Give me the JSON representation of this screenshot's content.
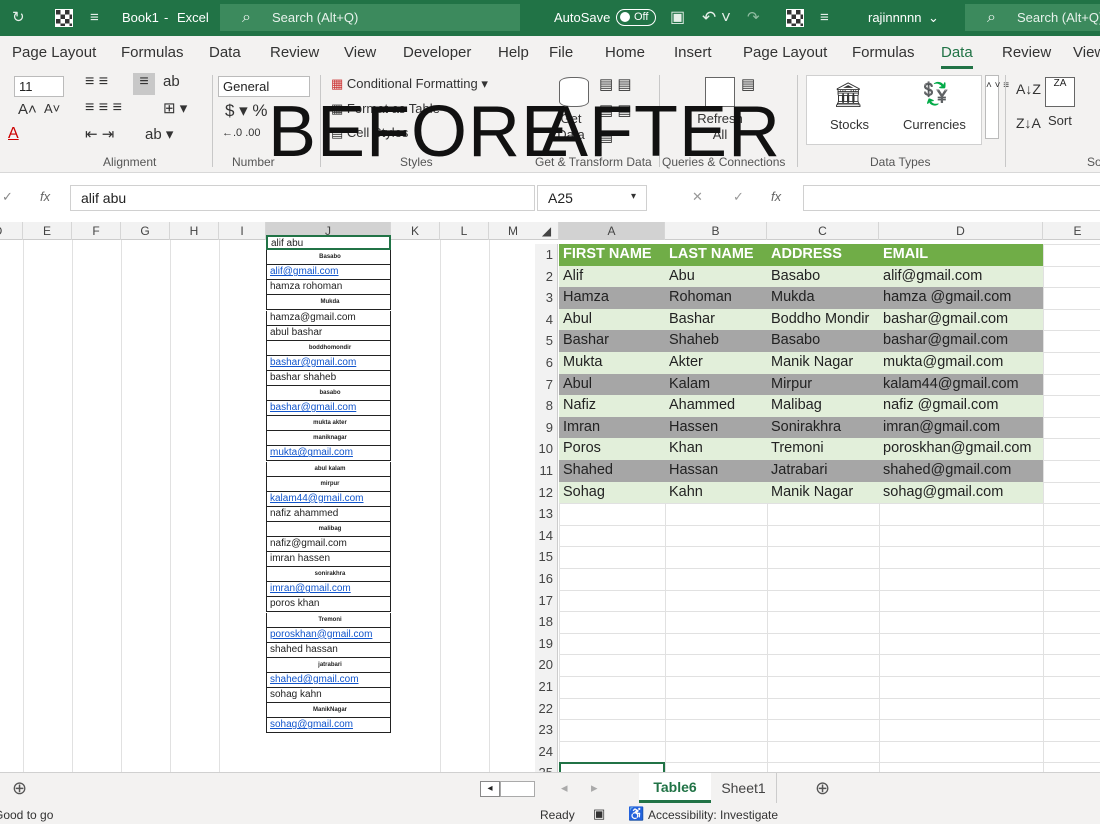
{
  "overlay": {
    "before": "BEFORE",
    "after": "AFTER"
  },
  "left": {
    "title": {
      "book": "Book1",
      "sep": "-",
      "app": "Excel",
      "search": "Search (Alt+Q)"
    },
    "menu": [
      "Page Layout",
      "Formulas",
      "Data",
      "Review",
      "View",
      "Developer",
      "Help"
    ],
    "ribbon": {
      "font_size": "11",
      "number_format": "General",
      "styles_items": [
        "Conditional Formatting",
        "Format as Table",
        "Cell Styles"
      ],
      "groups": [
        "Alignment",
        "Number",
        "Styles"
      ]
    },
    "formula": {
      "fx": "fx",
      "value": "alif abu"
    },
    "columns": [
      "D",
      "E",
      "F",
      "G",
      "H",
      "I",
      "J",
      "K",
      "L",
      "M"
    ],
    "j_cells": [
      {
        "text": "alif abu",
        "style": "normal"
      },
      {
        "text": "Basabo",
        "style": "tiny"
      },
      {
        "text": "alif@gmail.com",
        "style": "link"
      },
      {
        "text": "hamza rohoman",
        "style": "normal"
      },
      {
        "text": "Mukda",
        "style": "tiny"
      },
      {
        "text": "hamza@gmail.com",
        "style": "normal"
      },
      {
        "text": "abul bashar",
        "style": "normal"
      },
      {
        "text": "boddhomondir",
        "style": "tiny"
      },
      {
        "text": "bashar@gmail.com",
        "style": "link"
      },
      {
        "text": "bashar shaheb",
        "style": "normal"
      },
      {
        "text": "basabo",
        "style": "tiny"
      },
      {
        "text": "bashar@gmail.com",
        "style": "link"
      },
      {
        "text": "mukta akter",
        "style": "tiny"
      },
      {
        "text": "maniknagar",
        "style": "tiny"
      },
      {
        "text": "mukta@gmail.com",
        "style": "link"
      },
      {
        "text": "abul kalam",
        "style": "tiny"
      },
      {
        "text": "mirpur",
        "style": "tiny"
      },
      {
        "text": "kalam44@gmail.com",
        "style": "link"
      },
      {
        "text": "nafiz ahammed",
        "style": "normal"
      },
      {
        "text": "malibag",
        "style": "tiny"
      },
      {
        "text": "nafiz@gmail.com",
        "style": "normal"
      },
      {
        "text": "imran hassen",
        "style": "normal"
      },
      {
        "text": "sonirakhra",
        "style": "tiny"
      },
      {
        "text": "imran@gmail.com",
        "style": "link"
      },
      {
        "text": "poros khan",
        "style": "normal"
      },
      {
        "text": "Tremoni",
        "style": "tiny"
      },
      {
        "text": "poroskhan@gmail.com",
        "style": "link"
      },
      {
        "text": "shahed hassan",
        "style": "normal"
      },
      {
        "text": "jatrabari",
        "style": "tiny"
      },
      {
        "text": "shahed@gmail.com",
        "style": "link"
      },
      {
        "text": "sohag kahn",
        "style": "normal"
      },
      {
        "text": "ManikNagar",
        "style": "tiny"
      },
      {
        "text": "sohag@gmail.com",
        "style": "link"
      }
    ],
    "status": "Good to go"
  },
  "right": {
    "title": {
      "autosave": "AutoSave",
      "toggle": "Off",
      "user": "rajinnnnn",
      "search": "Search (Alt+Q)"
    },
    "menu": [
      "File",
      "Home",
      "Insert",
      "Page Layout",
      "Formulas",
      "Data",
      "Review",
      "View"
    ],
    "active_menu": "Data",
    "ribbon": {
      "get_data": "Get Data",
      "refresh": "Refresh All",
      "stocks": "Stocks",
      "currencies": "Currencies",
      "sort": "Sort",
      "groups": [
        "Get & Transform Data",
        "Queries & Connections",
        "Data Types",
        "So"
      ]
    },
    "formula": {
      "namebox": "A25",
      "fx": "fx",
      "value": ""
    },
    "columns": [
      "A",
      "B",
      "C",
      "D",
      "E"
    ],
    "row_numbers": [
      "1",
      "2",
      "3",
      "4",
      "5",
      "6",
      "7",
      "8",
      "9",
      "10",
      "11",
      "12",
      "13",
      "14",
      "15",
      "16",
      "17",
      "18",
      "19",
      "20",
      "21",
      "22",
      "23",
      "24",
      "25"
    ],
    "table": {
      "headers": [
        "FIRST NAME",
        "LAST NAME",
        "ADDRESS",
        "EMAIL"
      ],
      "rows": [
        [
          "Alif",
          "Abu",
          "Basabo",
          "alif@gmail.com"
        ],
        [
          "Hamza",
          "Rohoman",
          "Mukda",
          "hamza @gmail.com"
        ],
        [
          "Abul",
          "Bashar",
          "Boddho Mondir",
          "bashar@gmail.com"
        ],
        [
          "Bashar",
          "Shaheb",
          "Basabo",
          "bashar@gmail.com"
        ],
        [
          "Mukta",
          "Akter",
          "Manik Nagar",
          "mukta@gmail.com"
        ],
        [
          "Abul",
          "Kalam",
          "Mirpur",
          "kalam44@gmail.com"
        ],
        [
          "Nafiz",
          "Ahammed",
          "Malibag",
          "nafiz @gmail.com"
        ],
        [
          "Imran",
          "Hassen",
          "Sonirakhra",
          "imran@gmail.com"
        ],
        [
          "Poros",
          "Khan",
          "Tremoni",
          "poroskhan@gmail.com"
        ],
        [
          "Shahed",
          "Hassan",
          "Jatrabari",
          "shahed@gmail.com"
        ],
        [
          "Sohag",
          "Kahn",
          "Manik Nagar",
          "sohag@gmail.com"
        ]
      ]
    },
    "sheets": [
      "Table6",
      "Sheet1"
    ],
    "active_sheet": "Table6",
    "status": {
      "ready": "Ready",
      "accessibility": "Accessibility: Investigate"
    }
  },
  "colors": {
    "excel_green": "#217346",
    "table_header": "#70ad47",
    "band_light": "#e2efda",
    "band_dark": "#a6a6a6",
    "link": "#1155cc"
  }
}
